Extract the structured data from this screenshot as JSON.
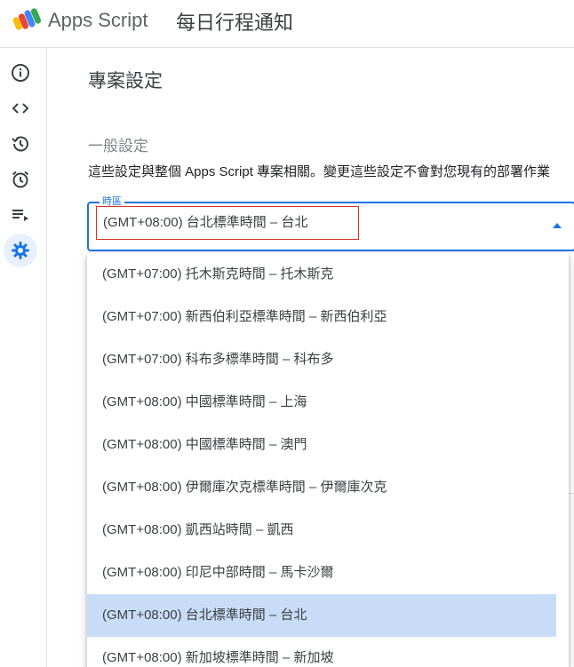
{
  "header": {
    "app_name": "Apps Script",
    "project_name": "每日行程通知"
  },
  "sidebar": {
    "items": [
      {
        "icon": "info-icon",
        "name": "overview"
      },
      {
        "icon": "code-icon",
        "name": "editor"
      },
      {
        "icon": "history-icon",
        "name": "executions"
      },
      {
        "icon": "alarm-icon",
        "name": "triggers"
      },
      {
        "icon": "playlist-icon",
        "name": "executions-list"
      },
      {
        "icon": "gear-icon",
        "name": "project-settings",
        "active": true
      }
    ]
  },
  "settings": {
    "page_title": "專案設定",
    "section_title": "一般設定",
    "section_desc": "這些設定與整個 Apps Script 專案相關。變更這些設定不會對您現有的部署作業",
    "timezone_label": "時區",
    "timezone_value": "(GMT+08:00) 台北標準時間 – 台北"
  },
  "dropdown": {
    "options": [
      "(GMT+07:00) 托木斯克時間 – 托木斯克",
      "(GMT+07:00) 新西伯利亞標準時間 – 新西伯利亞",
      "(GMT+07:00) 科布多標準時間 – 科布多",
      "(GMT+08:00) 中國標準時間 – 上海",
      "(GMT+08:00) 中國標準時間 – 澳門",
      "(GMT+08:00) 伊爾庫次克標準時間 – 伊爾庫次克",
      "(GMT+08:00) 凱西站時間 – 凱西",
      "(GMT+08:00) 印尼中部時間 – 馬卡沙爾",
      "(GMT+08:00) 台北標準時間 – 台北",
      "(GMT+08:00) 新加坡標準時間 – 新加坡"
    ],
    "selected_index": 8
  },
  "colors": {
    "accent": "#1a73e8",
    "highlight": "#d93025",
    "selected_bg": "#c9dcf7"
  }
}
